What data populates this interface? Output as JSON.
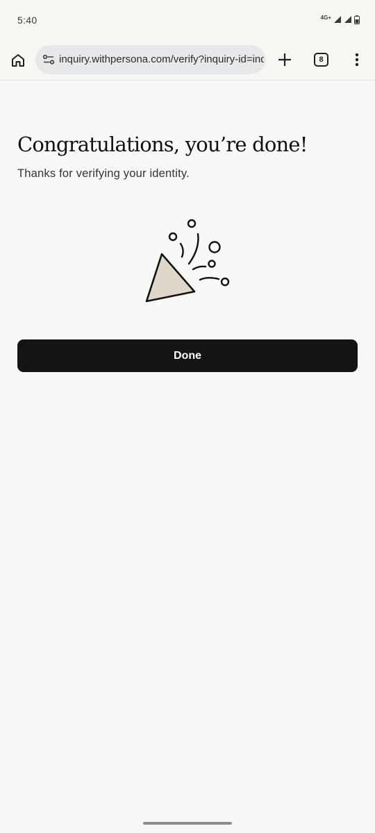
{
  "status_bar": {
    "time": "5:40",
    "network_label": "4G+"
  },
  "browser": {
    "url": "inquiry.withpersona.com/verify?inquiry-id=inq",
    "tab_count": "8",
    "icons": [
      "home-icon",
      "site-settings-icon",
      "plus-icon",
      "tab-switcher-icon",
      "more-vert-icon"
    ]
  },
  "page": {
    "title": "Congratulations, you’re done!",
    "subtitle": "Thanks for verifying your identity.",
    "illustration": "party-popper-icon",
    "done_button_label": "Done"
  },
  "colors": {
    "page_background": "#f9f8f6",
    "button_background": "#141414",
    "button_text": "#ffffff",
    "popper_fill": "#e0d7cb"
  }
}
